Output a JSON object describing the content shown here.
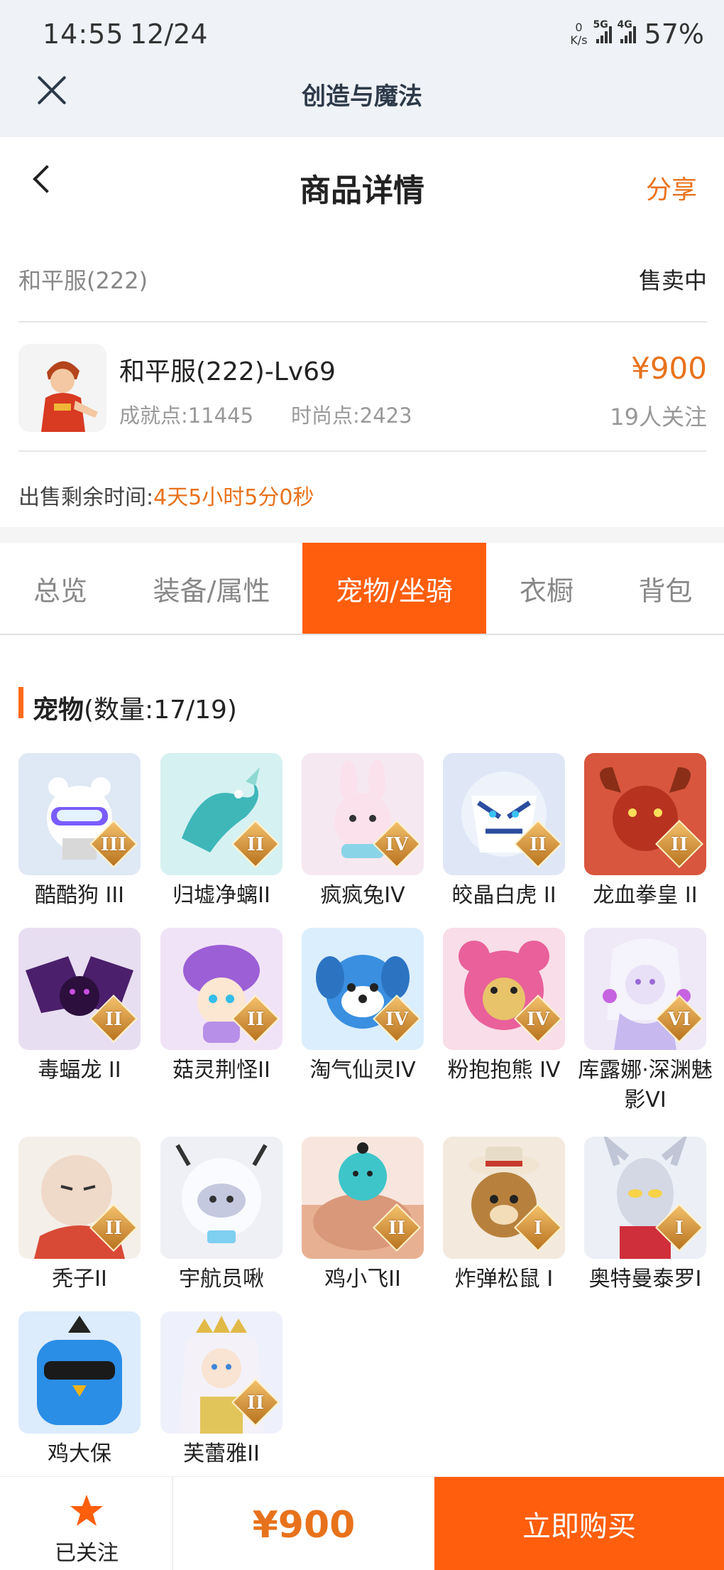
{
  "status_bar": {
    "time": "14:55",
    "date": "12/24",
    "speed_top": "0",
    "speed_unit": "K/s",
    "net1": "5G",
    "net2": "4G",
    "battery": "57%"
  },
  "app_bar": {
    "title": "创造与魔法"
  },
  "header": {
    "title": "商品详情",
    "share": "分享"
  },
  "listing": {
    "server": "和平服(222)",
    "state": "售卖中",
    "name": "和平服(222)-Lv69",
    "achievement": "成就点:11445",
    "fashion": "时尚点:2423",
    "price": "¥900",
    "followers": "19人关注",
    "remain_label": "出售剩余时间:",
    "remain_value": "4天5小时5分0秒"
  },
  "tabs": [
    "总览",
    "装备/属性",
    "宠物/坐骑",
    "衣橱",
    "背包"
  ],
  "pets_section": {
    "title": "宠物",
    "count": "(数量:17/19)"
  },
  "pets": [
    {
      "name": "酷酷狗 III",
      "badge": "III",
      "color": "#dfe8f5",
      "accent": "#7a5cff",
      "icon": "bear-dog"
    },
    {
      "name": "归墟净螭II",
      "badge": "II",
      "color": "#d6f1f2",
      "accent": "#3fb7b9",
      "icon": "dragon"
    },
    {
      "name": "疯疯兔IV",
      "badge": "IV",
      "color": "#f6e8f0",
      "accent": "#f2a6c4",
      "icon": "rabbit"
    },
    {
      "name": "皎晶白虎 II",
      "badge": "II",
      "color": "#dfe7f7",
      "accent": "#2b4d9e",
      "icon": "tiger"
    },
    {
      "name": "龙血拳皇 II",
      "badge": "II",
      "color": "#f4d8d2",
      "accent": "#c8331f",
      "icon": "demon"
    },
    {
      "name": "毒蝠龙 II",
      "badge": "II",
      "color": "#e8def2",
      "accent": "#4b1f6b",
      "icon": "bat-dragon"
    },
    {
      "name": "菇灵荆怪II",
      "badge": "II",
      "color": "#f1e3f7",
      "accent": "#9c5fd6",
      "icon": "mushroom"
    },
    {
      "name": "淘气仙灵IV",
      "badge": "IV",
      "color": "#dbeefe",
      "accent": "#3a8fe0",
      "icon": "blue-pup"
    },
    {
      "name": "粉抱抱熊 IV",
      "badge": "IV",
      "color": "#f9dde8",
      "accent": "#e9609a",
      "icon": "pink-bear"
    },
    {
      "name": "库露娜·深渊魅影VI",
      "badge": "VI",
      "color": "#eee8f7",
      "accent": "#c7b8ef",
      "icon": "siren"
    },
    {
      "name": "秃子II",
      "badge": "II",
      "color": "#f4efe9",
      "accent": "#d94a36",
      "icon": "bald"
    },
    {
      "name": "宇航员啾",
      "badge": "",
      "color": "#eef0f5",
      "accent": "#7d88b5",
      "icon": "astronaut"
    },
    {
      "name": "鸡小飞II",
      "badge": "II",
      "color": "#f8e6de",
      "accent": "#3ec5c9",
      "icon": "muscle"
    },
    {
      "name": "炸弹松鼠 I",
      "badge": "I",
      "color": "#f3e9dd",
      "accent": "#b7813d",
      "icon": "squirrel"
    },
    {
      "name": "奥特曼泰罗I",
      "badge": "I",
      "color": "#eceff6",
      "accent": "#cf2e3b",
      "icon": "hero"
    },
    {
      "name": "鸡大保",
      "badge": "",
      "color": "#dcecfd",
      "accent": "#2a8de6",
      "icon": "bird-cool"
    },
    {
      "name": "芙蕾雅II",
      "badge": "II",
      "color": "#eef1fb",
      "accent": "#e1b947",
      "icon": "goddess"
    }
  ],
  "bottom_bar": {
    "follow_label": "已关注",
    "price": "¥900",
    "buy_label": "立即购买"
  },
  "colors": {
    "accent": "#ff5e0d",
    "price": "#e8721c",
    "app_bar_bg": "#eff3f7"
  }
}
